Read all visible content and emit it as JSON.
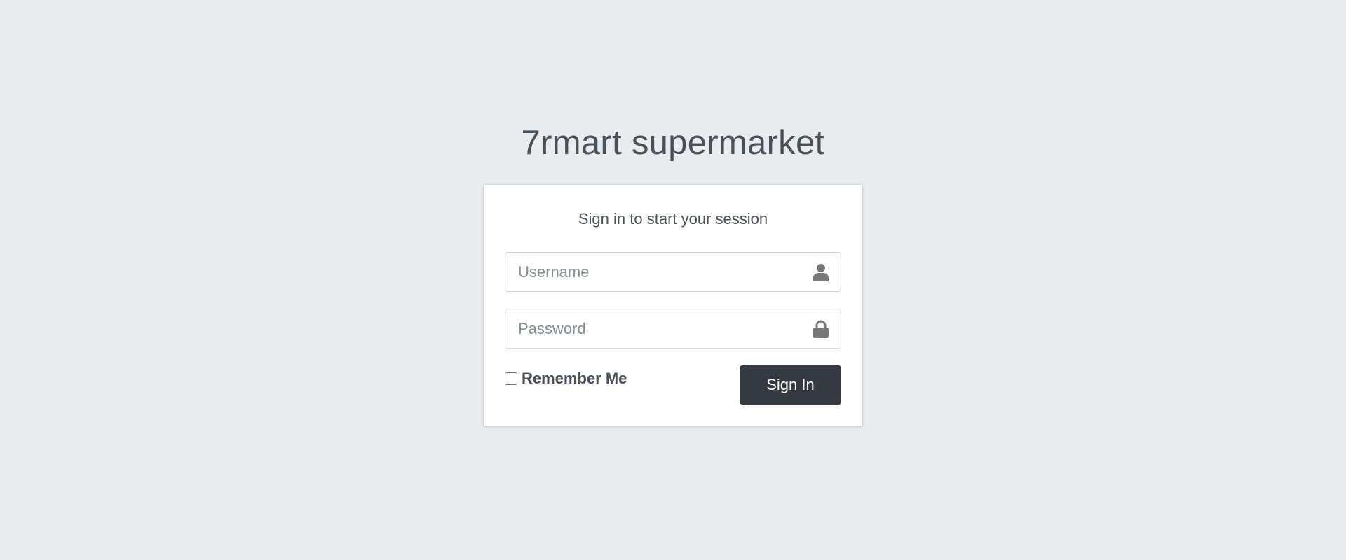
{
  "brand": {
    "title": "7rmart supermarket"
  },
  "login": {
    "message": "Sign in to start your session",
    "username": {
      "placeholder": "Username",
      "value": "",
      "icon": "user-icon"
    },
    "password": {
      "placeholder": "Password",
      "value": "",
      "icon": "lock-icon"
    },
    "remember": {
      "label": "Remember Me",
      "checked": false
    },
    "submit_label": "Sign In"
  },
  "colors": {
    "background": "#e9ecef",
    "button": "#343a40",
    "icon": "#777777"
  }
}
